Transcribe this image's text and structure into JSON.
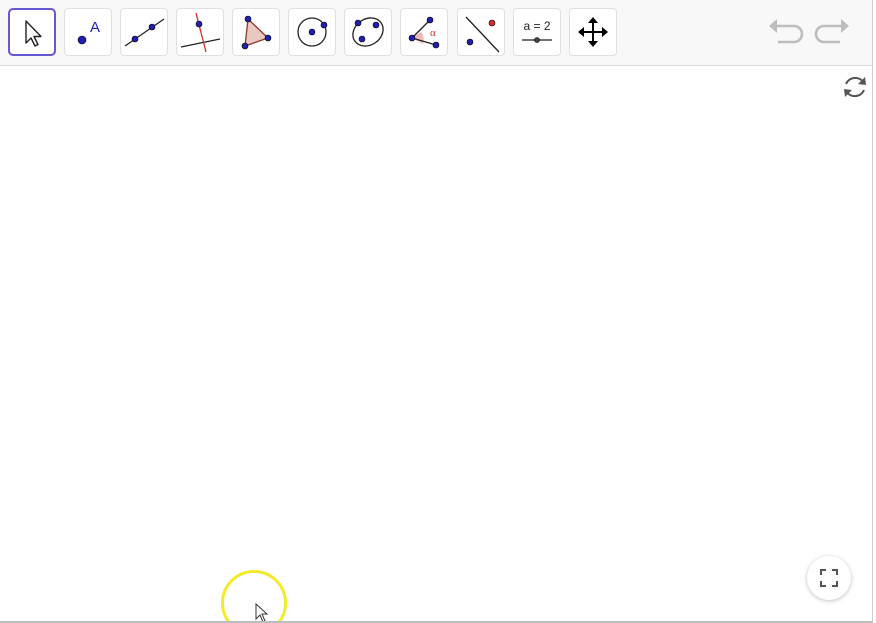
{
  "toolbar": {
    "tools": [
      {
        "name": "move-tool",
        "icon": "arrow-cursor-icon",
        "selected": true
      },
      {
        "name": "point-tool",
        "icon": "point-icon",
        "label": "A"
      },
      {
        "name": "line-tool",
        "icon": "line-through-two-points-icon"
      },
      {
        "name": "perpendicular-line-tool",
        "icon": "perpendicular-line-icon"
      },
      {
        "name": "polygon-tool",
        "icon": "polygon-icon"
      },
      {
        "name": "circle-center-point-tool",
        "icon": "circle-center-point-icon"
      },
      {
        "name": "conic-five-points-tool",
        "icon": "conic-five-points-icon"
      },
      {
        "name": "angle-tool",
        "icon": "angle-icon",
        "label": "α"
      },
      {
        "name": "reflect-about-line-tool",
        "icon": "reflect-about-line-icon"
      },
      {
        "name": "slider-tool",
        "icon": "slider-icon",
        "label": "a = 2"
      },
      {
        "name": "move-graphics-view-tool",
        "icon": "move-graphics-view-icon"
      }
    ],
    "undo_icon": "undo-icon",
    "redo_icon": "redo-icon"
  },
  "canvas": {
    "reset_icon": "reset-construction-icon",
    "fullscreen_icon": "fullscreen-icon"
  },
  "colors": {
    "selected_border": "#6557d2",
    "point_blue": "#1f1fb0",
    "accent_red": "#d32f2f",
    "polygon_fill": "#e8c8c0",
    "click_highlight": "#f3ea2b"
  }
}
